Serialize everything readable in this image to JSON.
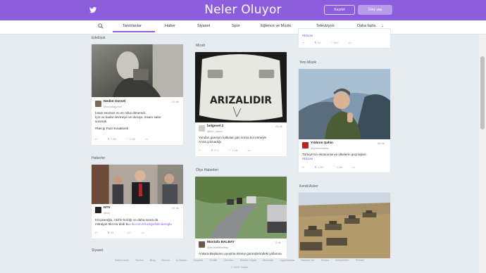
{
  "header": {
    "brand": "Neler Oluyor",
    "login_label": "Kaydol",
    "signup_label": "Giriş yap",
    "brand_color": "#8c5ddd"
  },
  "nav": {
    "items": [
      "Tanıtılanlar",
      "Haber",
      "Siyaset",
      "Spor",
      "Eğlence ve Müzik",
      "Televizyon",
      "Daha fazla"
    ],
    "active": "Tanıtılanlar"
  },
  "columns": {
    "left": {
      "section1": "Edebiyat",
      "card1": {
        "author": "Nedim Gürsel",
        "handle": "@nedimgursel",
        "time": "21 dk",
        "text_lines": [
          "İnsan sevmez mi en nihai dönemdi,",
          "İçin ne kadar sevmeye ve duruşu, insanı sabır",
          "sunmak."
        ],
        "link_text": "#Necip Fazıl Kısakürek",
        "stats": [
          "",
          "1,5B",
          "2,9B",
          ""
        ]
      },
      "section2": "Haberler",
      "card2": {
        "author": "NTV",
        "handle": "@ntv",
        "time": "17 dk",
        "text_lines": [
          "Kılıçdaroğlu, Akıl'le kırdığı ve daha sonra da",
          "mitralyet ölü mü dedi bu"
        ],
        "link_text": "ntv.com.tr/turkiye/kilicdaroglu",
        "stats": [
          "",
          "33",
          "127",
          ""
        ]
      },
      "section3": "Siyaset"
    },
    "middle": {
      "top_label": "Mizah",
      "card1": {
        "image_text": "ARIZALIDIR",
        "author": "belgesel 2",
        "handle": "@bel_sizlen",
        "time": "23 dk",
        "text_lines": [
          "Yondan güneyin kalkalar gün sonra kol etmeyle",
          "Arıza çıkmadığı."
        ],
        "stats": [
          "",
          "371",
          "3,1B",
          ""
        ]
      },
      "section2": "Ölçe Haberleri",
      "card2": {
        "author": "Mustafa BALBAY",
        "handle": "@mustafabalbay",
        "time": "2 dk",
        "text_lines": [
          "Ankara Başkanın uyuşma köneyi gümüşlerindeki yollarına"
        ],
        "stats": []
      }
    },
    "right": {
      "top_card": {
        "link_text": "#Ekose",
        "stats": [
          "",
          "64",
          "552",
          ""
        ]
      },
      "section1": "Yeni Müzik",
      "card1": {
        "author": "Yıldırım Şahin",
        "handle": "@yildirimsahin",
        "time": "36 dk",
        "text_lines": [
          "Türkiye'nin ekonomisi ve ülkelerin geçmişleri."
        ],
        "link_text": "#Ekose",
        "stats": [
          "",
          "1,5B",
          "2,6B",
          ""
        ]
      },
      "section2": "Kendi Asker"
    }
  },
  "footer": {
    "links": [
      "Hakkımızda",
      "Yardım",
      "Blog",
      "Durum",
      "İş İlanları",
      "Koşullar",
      "Gizlilik",
      "Çerezler",
      "Reklam bilgisi",
      "Markalar",
      "Uygulamalar",
      "Reklam ver",
      "Medya",
      "Geliştiriciler",
      "Rehber"
    ],
    "copyright": "© 2016 Twitter"
  }
}
